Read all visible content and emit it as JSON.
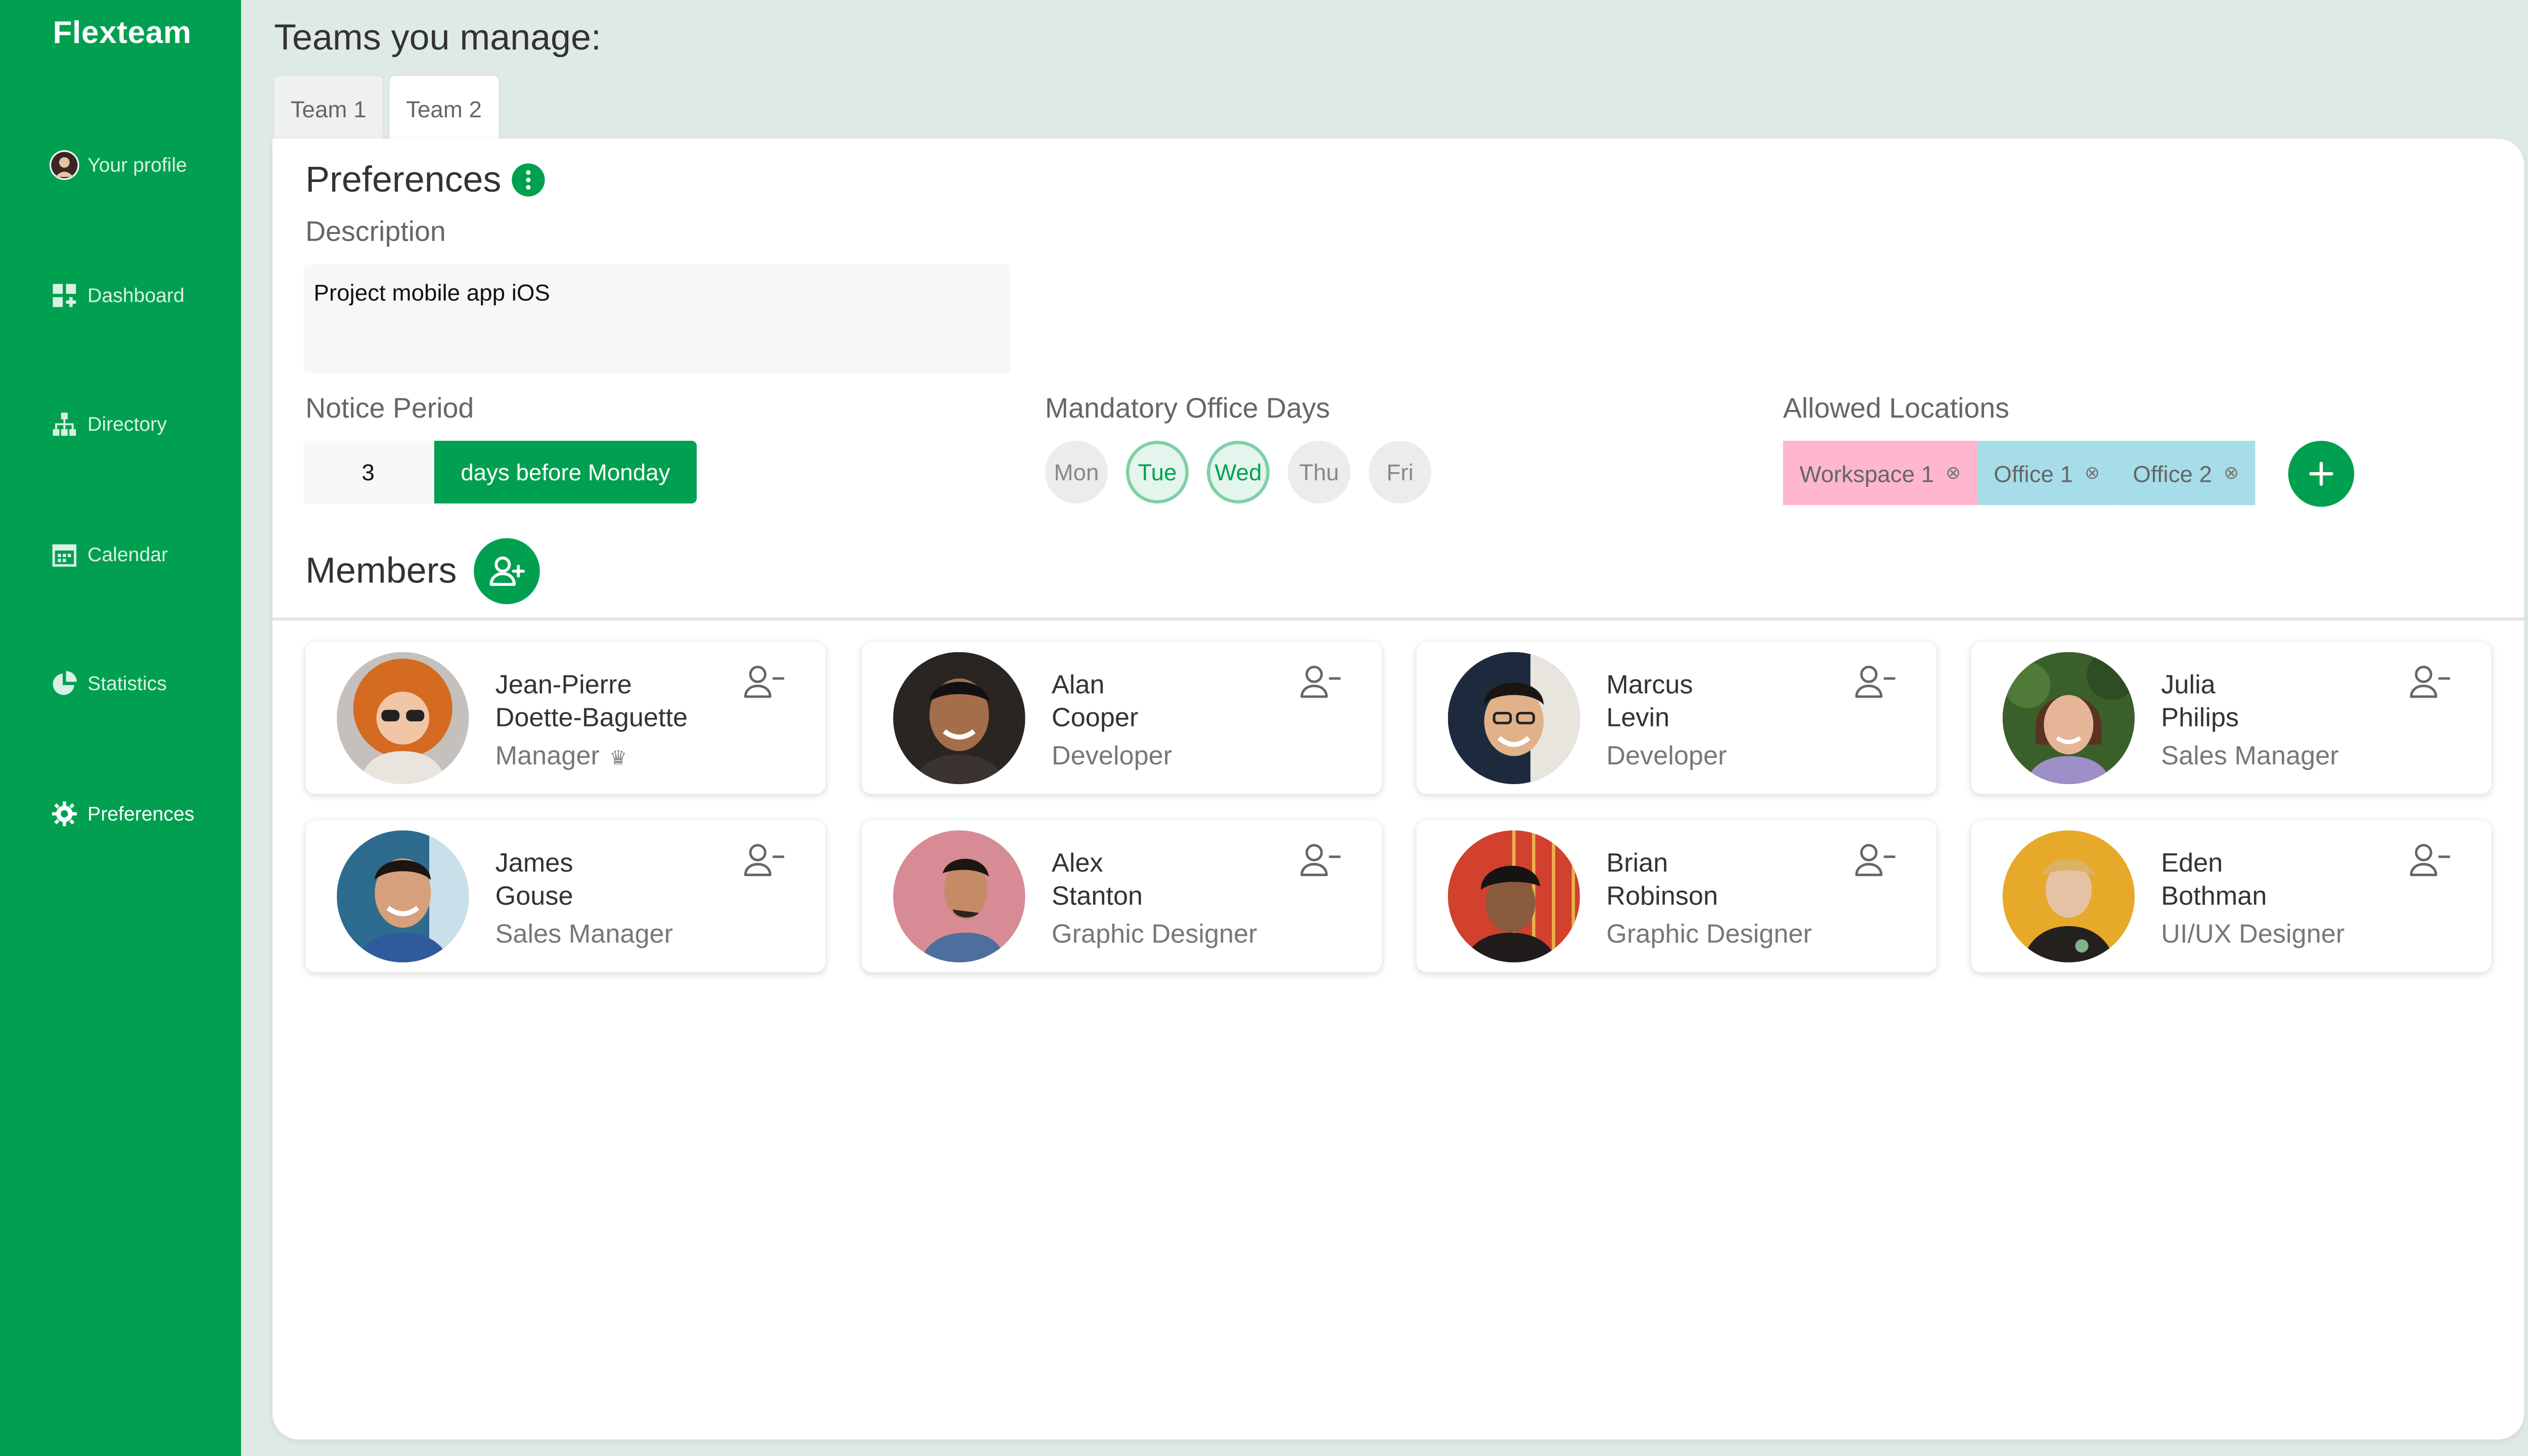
{
  "app": {
    "brand": "Flexteam"
  },
  "sidebar": {
    "items": [
      {
        "label": "Your profile",
        "icon": "avatar"
      },
      {
        "label": "Dashboard",
        "icon": "dashboard-icon"
      },
      {
        "label": "Directory",
        "icon": "org-chart-icon"
      },
      {
        "label": "Calendar",
        "icon": "calendar-icon"
      },
      {
        "label": "Statistics",
        "icon": "pie-chart-icon"
      },
      {
        "label": "Preferences",
        "icon": "gear-icon",
        "active": true
      }
    ]
  },
  "page": {
    "title": "Teams you manage:"
  },
  "tabs": [
    {
      "label": "Team 1"
    },
    {
      "label": "Team 2",
      "active": true
    }
  ],
  "preferences": {
    "title": "Preferences",
    "description_label": "Description",
    "description_value": "Project mobile app iOS",
    "notice_label": "Notice Period",
    "notice_value": "3",
    "notice_unit": "days before Monday",
    "office_days_label": "Mandatory Office Days",
    "days": [
      {
        "label": "Mon",
        "selected": false
      },
      {
        "label": "Tue",
        "selected": true
      },
      {
        "label": "Wed",
        "selected": true
      },
      {
        "label": "Thu",
        "selected": false
      },
      {
        "label": "Fri",
        "selected": false
      }
    ],
    "locations_label": "Allowed Locations",
    "locations": [
      {
        "label": "Workspace 1",
        "color": "#ffb6cf"
      },
      {
        "label": "Office 1",
        "color": "#a6dde9"
      },
      {
        "label": "Office 2",
        "color": "#a6dde9"
      }
    ]
  },
  "members": {
    "title": "Members",
    "list": [
      {
        "first": "Jean-Pierre",
        "last": "Doette-Baguette",
        "role": "Manager",
        "manager": true
      },
      {
        "first": "Alan",
        "last": "Cooper",
        "role": "Developer"
      },
      {
        "first": "Marcus",
        "last": "Levin",
        "role": "Developer"
      },
      {
        "first": "Julia",
        "last": "Philips",
        "role": "Sales Manager"
      },
      {
        "first": "James",
        "last": "Gouse",
        "role": "Sales Manager"
      },
      {
        "first": "Alex",
        "last": "Stanton",
        "role": "Graphic Designer"
      },
      {
        "first": "Brian",
        "last": "Robinson",
        "role": "Graphic Designer"
      },
      {
        "first": "Eden",
        "last": "Bothman",
        "role": "UI/UX Designer"
      }
    ]
  },
  "colors": {
    "accent": "#00a050",
    "background": "#dfeae6"
  }
}
